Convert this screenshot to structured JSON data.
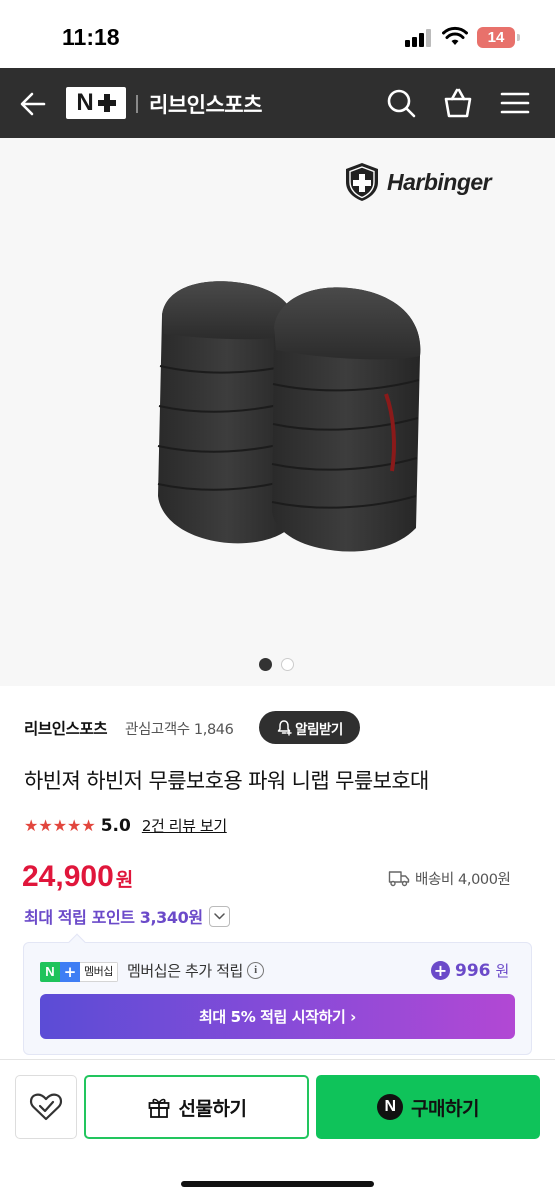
{
  "status_bar": {
    "time": "11:18",
    "battery": "14",
    "battery_color": "#e8716b"
  },
  "header": {
    "logo_letter": "N",
    "store_name": "리브인스포츠",
    "icons": [
      "back-arrow-icon",
      "search-icon",
      "shopping-bag-icon",
      "menu-icon"
    ],
    "background": "#2f2f2f"
  },
  "product_image": {
    "brand": "Harbinger",
    "slide_count": 2,
    "active_slide": 1
  },
  "seller": {
    "name": "리브인스포츠",
    "followers": "관심고객수 1,846",
    "alarm_label": "알림받기"
  },
  "product": {
    "title": "하빈져 하빈저 무릎보호용 파워 니랩 무릎보호대",
    "stars": "★★★★★",
    "rating": "5.0",
    "review_link": "2건 리뷰 보기"
  },
  "price": {
    "amount": "24,900",
    "currency": "원",
    "color": "#e0163b",
    "shipping": "배송비 4,000원",
    "max_points": "최대 적립 포인트 3,340원"
  },
  "membership": {
    "badge_label": "멤버십",
    "text": "멤버십은 추가 적립",
    "info_symbol": "i",
    "extra_points": "996",
    "extra_points_unit": "원",
    "cta": "최대 5% 적립 시작하기 ›",
    "accent": "#6b4ac9"
  },
  "bottom_bar": {
    "gift_label": "선물하기",
    "buy_label": "구매하기",
    "buy_color": "#0fc35a"
  }
}
